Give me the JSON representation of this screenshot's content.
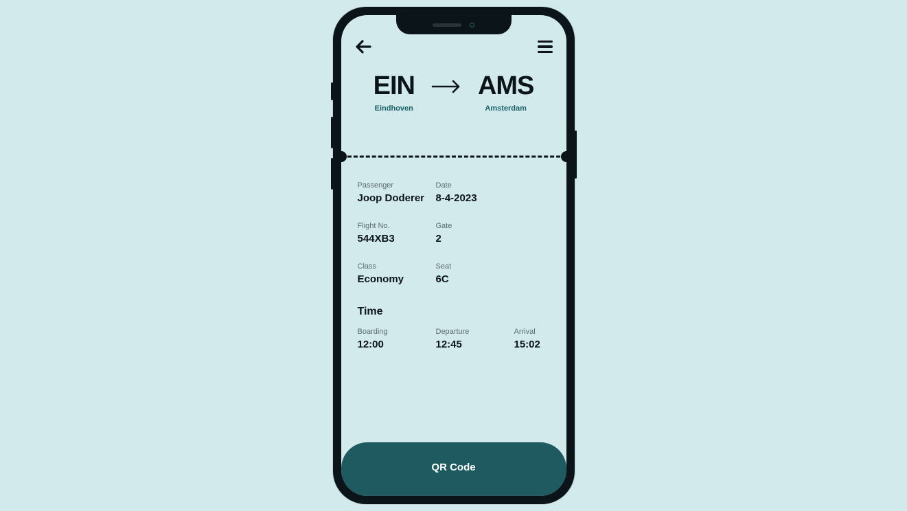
{
  "route": {
    "origin": {
      "code": "EIN",
      "city": "Eindhoven"
    },
    "destination": {
      "code": "AMS",
      "city": "Amsterdam"
    }
  },
  "labels": {
    "passenger": "Passenger",
    "date": "Date",
    "flight_no": "Flight No.",
    "gate": "Gate",
    "class": "Class",
    "seat": "Seat",
    "time": "Time",
    "boarding": "Boarding",
    "departure": "Departure",
    "arrival": "Arrival"
  },
  "details": {
    "passenger": "Joop Doderer",
    "date": "8-4-2023",
    "flight_no": "544XB3",
    "gate": "2",
    "class": "Economy",
    "seat": "6C"
  },
  "times": {
    "boarding": "12:00",
    "departure": "12:45",
    "arrival": "15:02"
  },
  "qr_button": "QR Code"
}
